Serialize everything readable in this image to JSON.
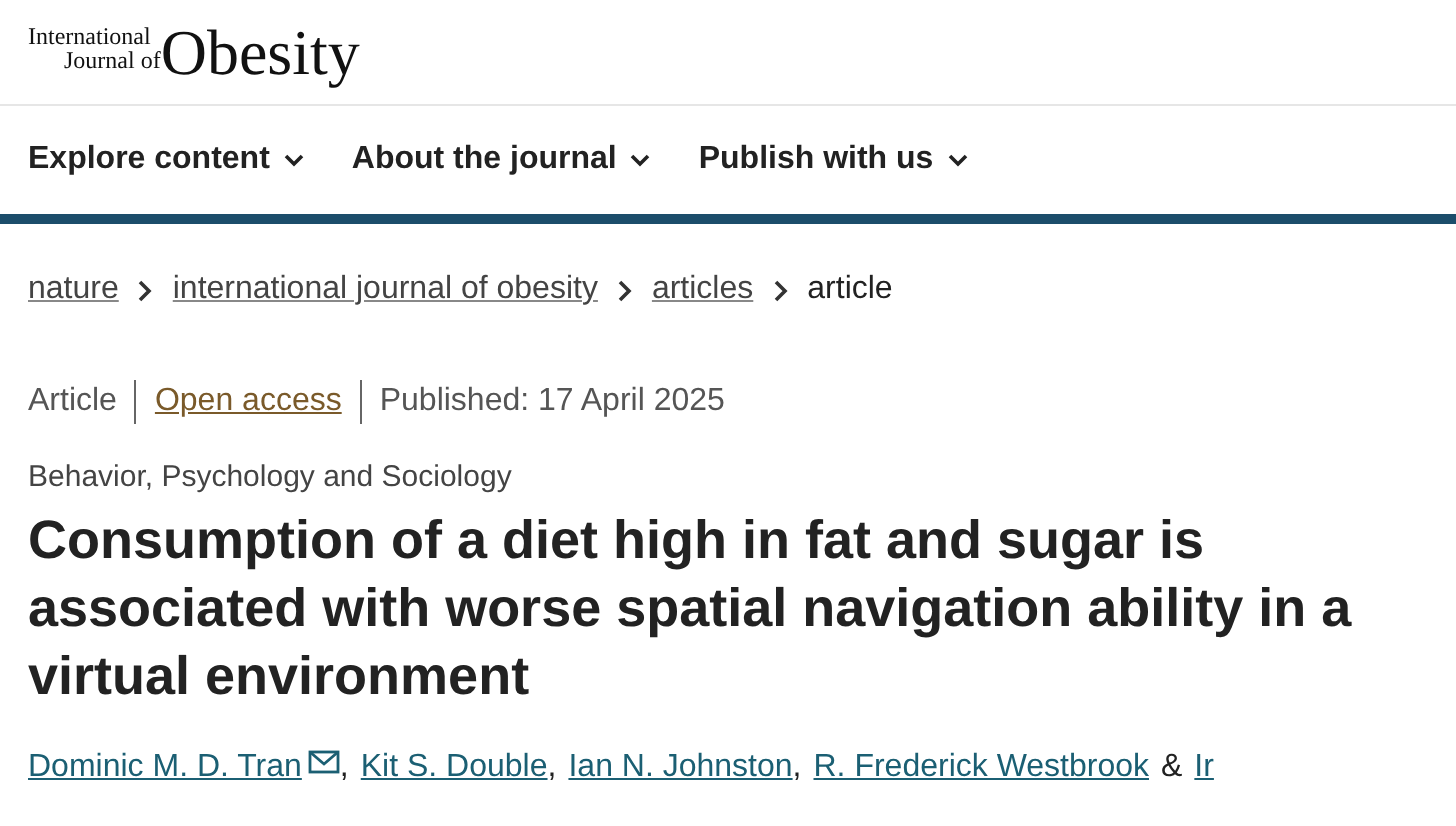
{
  "logo": {
    "line_1": "International",
    "line_2": "Journal of",
    "word": "Obesity"
  },
  "nav": [
    {
      "label": "Explore content"
    },
    {
      "label": "About the journal"
    },
    {
      "label": "Publish with us"
    }
  ],
  "breadcrumbs": [
    {
      "label": "nature",
      "link": true
    },
    {
      "label": "international journal of obesity",
      "link": true
    },
    {
      "label": "articles",
      "link": true
    },
    {
      "label": "article",
      "link": false
    }
  ],
  "meta": {
    "type": "Article",
    "access": "Open access",
    "published": "Published: 17 April 2025"
  },
  "subject": "Behavior, Psychology and Sociology",
  "title": "Consumption of a diet high in fat and sugar is associated with worse spatial navigation ability in a virtual environment",
  "authors": [
    {
      "name": "Dominic M. D. Tran",
      "email": true,
      "sep": ","
    },
    {
      "name": "Kit S. Double",
      "email": false,
      "sep": ","
    },
    {
      "name": "Ian N. Johnston",
      "email": false,
      "sep": ","
    },
    {
      "name": "R. Frederick Westbrook",
      "email": false,
      "sep": "&"
    },
    {
      "name": "Ir",
      "email": false
    }
  ]
}
